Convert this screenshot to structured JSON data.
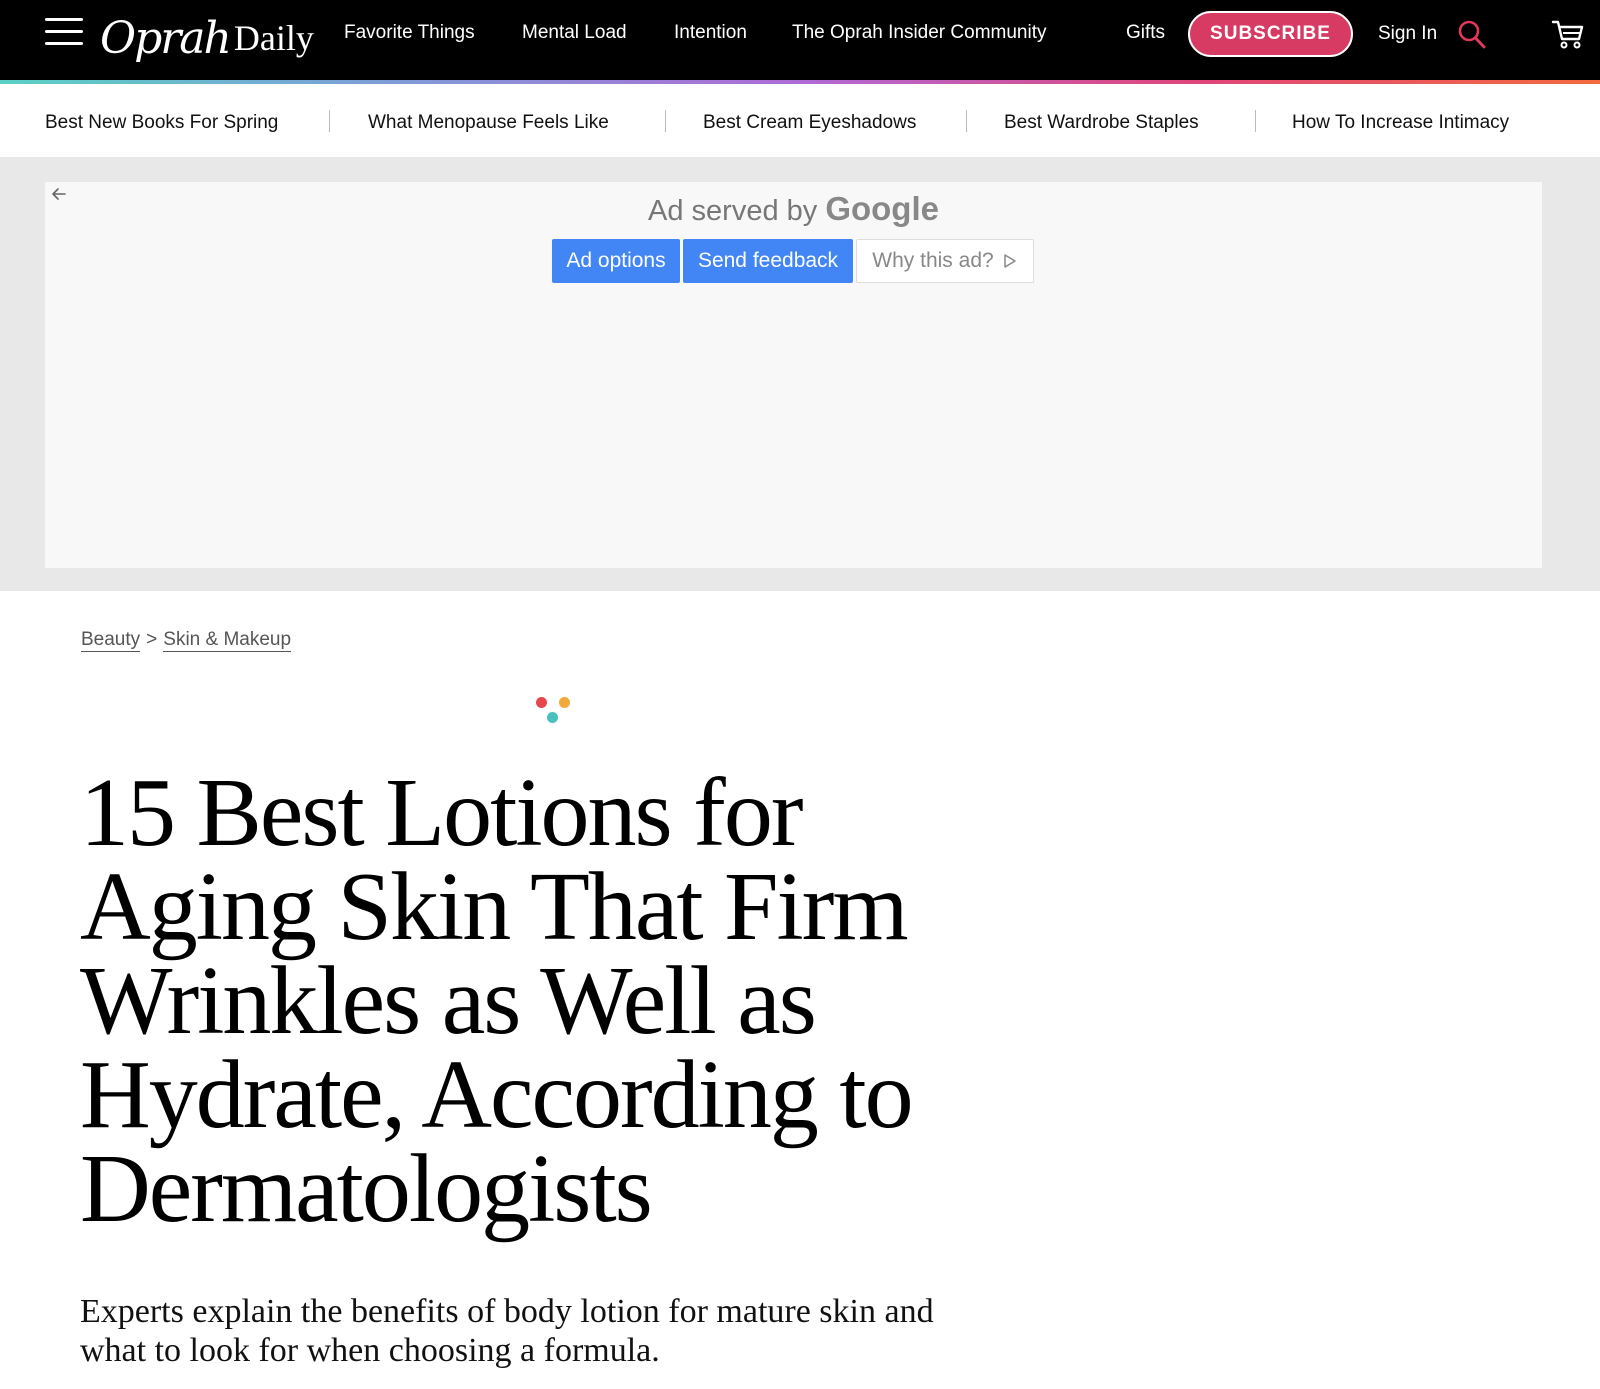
{
  "header": {
    "logo_script": "Oprah",
    "logo_text": "Daily",
    "nav": [
      "Favorite Things",
      "Mental Load",
      "Intention",
      "The Oprah Insider Community",
      "Gifts"
    ],
    "subscribe_label": "SUBSCRIBE",
    "sign_in_label": "Sign In",
    "accent_color": "#d73a62"
  },
  "trending": [
    "Best New Books For Spring",
    "What Menopause Feels Like",
    "Best Cream Eyeshadows",
    "Best Wardrobe Staples",
    "How To Increase Intimacy"
  ],
  "ad": {
    "served_by": "Ad served by",
    "brand": "Google",
    "options_label": "Ad options",
    "feedback_label": "Send feedback",
    "why_label": "Why this ad?"
  },
  "breadcrumb": {
    "items": [
      "Beauty",
      "Skin & Makeup"
    ],
    "separator": ">"
  },
  "article": {
    "headline": "15 Best Lotions for Aging Skin That Firm Wrinkles as Well as Hydrate, According to Dermatologists",
    "dek": "Experts explain the benefits of body lotion for mature skin and what to look for when choosing a formula."
  },
  "loader_colors": [
    "#e8464d",
    "#f2a93b",
    "#46c1bd"
  ]
}
